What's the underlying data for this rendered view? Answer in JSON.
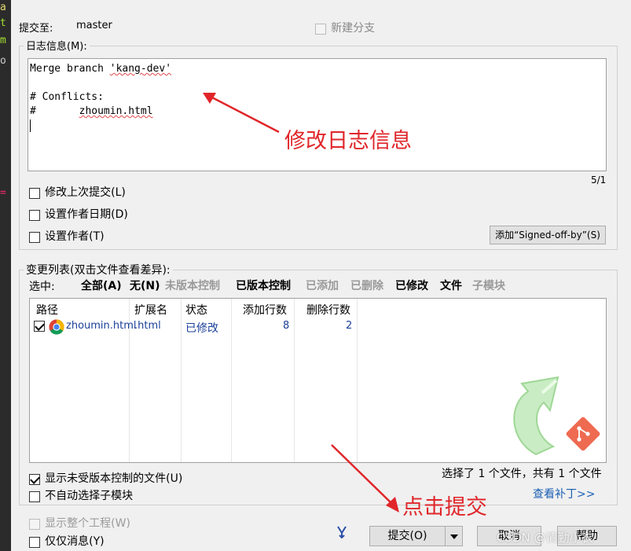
{
  "commit_to": {
    "label": "提交至:",
    "branch": "master"
  },
  "new_branch": {
    "label": "新建分支",
    "checked": false
  },
  "log_message": {
    "label": "日志信息(M):",
    "lines": [
      "Merge branch 'kang-dev'",
      "",
      "# Conflicts:",
      "#       zhoumin.html"
    ],
    "branch_word": "'kang-dev'",
    "file_word": "zhoumin.html",
    "counter": "5/1"
  },
  "options": {
    "amend": "修改上次提交(L)",
    "set_author_date": "设置作者日期(D)",
    "set_author": "设置作者(T)",
    "signed_off_button": "添加“Signed-off-by”(S)"
  },
  "changes": {
    "label": "变更列表(双击文件查看差异):",
    "select_label": "选中:",
    "filters": [
      {
        "label": "全部(A)",
        "enabled": true
      },
      {
        "label": "无(N)",
        "enabled": true
      },
      {
        "label": "未版本控制",
        "enabled": false
      },
      {
        "label": "已版本控制",
        "enabled": true
      },
      {
        "label": "已添加",
        "enabled": false
      },
      {
        "label": "已删除",
        "enabled": false
      },
      {
        "label": "已修改",
        "enabled": true
      },
      {
        "label": "文件",
        "enabled": true
      },
      {
        "label": "子模块",
        "enabled": false
      }
    ],
    "columns": [
      "路径",
      "扩展名",
      "状态",
      "添加行数",
      "删除行数"
    ],
    "rows": [
      {
        "checked": true,
        "path": "zhoumin.html",
        "ext": ".html",
        "status": "已修改",
        "added": "8",
        "deleted": "2"
      }
    ],
    "show_unversioned": "显示未受版本控制的文件(U)",
    "no_auto_select_submodules": "不自动选择子模块",
    "summary": "选择了 1 个文件，共有 1 个文件",
    "view_patch": "查看补丁>>"
  },
  "bottom": {
    "show_whole_project": "显示整个工程(W)",
    "message_only": "仅仅消息(Y)",
    "commit_button": "提交(O)",
    "cancel_button": "取消",
    "help_button": "帮助",
    "watermark": "CSDN @情勤小衣"
  },
  "annotations": {
    "edit_log": "修改日志信息",
    "click_commit": "点击提交"
  },
  "colors": {
    "annotation": "#e0262a",
    "link": "#1a5fb4",
    "background": "#f0f0f0"
  }
}
